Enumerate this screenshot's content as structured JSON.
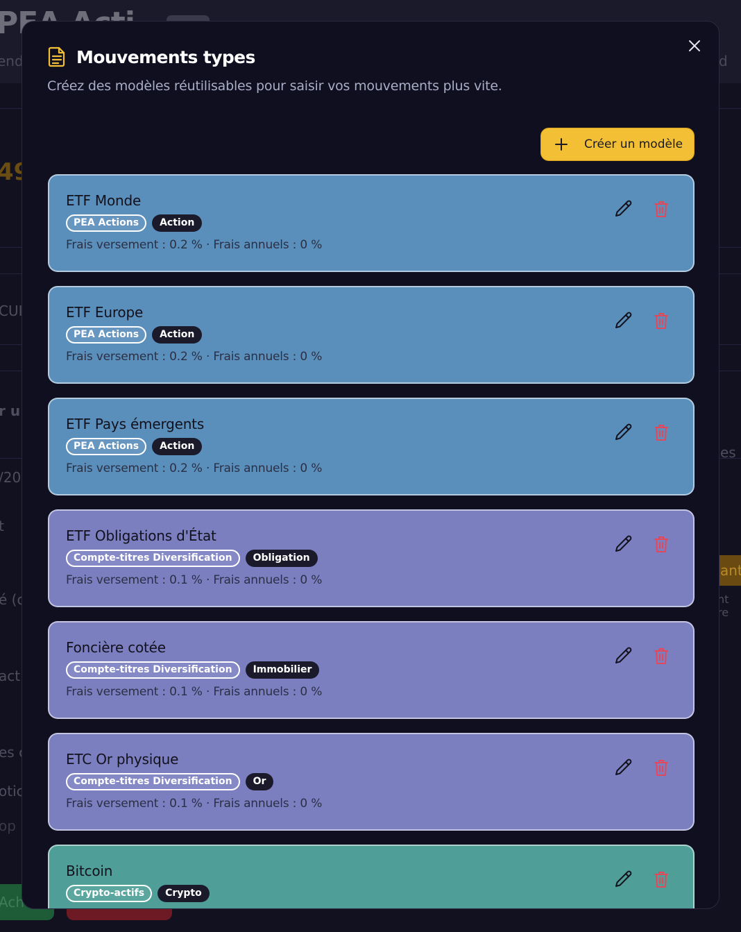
{
  "background": {
    "title_fragment": "PEA Acti",
    "subtitle_fragment": "end",
    "subtitle_fragment_right": "d",
    "value_fragment": "49.",
    "side_fragments": [
      "CUI",
      "r u",
      "/20",
      "t",
      "é (c",
      "acti",
      "es c",
      "otic",
      "op",
      "Ach"
    ],
    "right_fragments": [
      "es",
      "ant",
      "nt re"
    ]
  },
  "modal": {
    "icon": "document-icon",
    "title": "Mouvements types",
    "subtitle": "Créez des modèles réutilisables pour saisir vos mouvements plus vite.",
    "close_icon": "close-icon",
    "create_button": {
      "icon": "plus-icon",
      "label": "Créer un modèle"
    }
  },
  "colors": {
    "accent": "#f3c035",
    "card_pea": "#5b8fbb",
    "card_cto": "#7b7fc0",
    "card_crypto": "#4f9f98",
    "delete": "#e5475a"
  },
  "templates": [
    {
      "name": "ETF Monde",
      "account": "PEA Actions",
      "asset_class": "Action",
      "fees": "Frais versement : 0.2 % · Frais annuels : 0 %",
      "color": "#5b8fbb"
    },
    {
      "name": "ETF Europe",
      "account": "PEA Actions",
      "asset_class": "Action",
      "fees": "Frais versement : 0.2 % · Frais annuels : 0 %",
      "color": "#5b8fbb"
    },
    {
      "name": "ETF Pays émergents",
      "account": "PEA Actions",
      "asset_class": "Action",
      "fees": "Frais versement : 0.2 % · Frais annuels : 0 %",
      "color": "#5b8fbb"
    },
    {
      "name": "ETF Obligations d'État",
      "account": "Compte-titres Diversification",
      "asset_class": "Obligation",
      "fees": "Frais versement : 0.1 % · Frais annuels : 0 %",
      "color": "#7b7fc0"
    },
    {
      "name": "Foncière cotée",
      "account": "Compte-titres Diversification",
      "asset_class": "Immobilier",
      "fees": "Frais versement : 0.1 % · Frais annuels : 0 %",
      "color": "#7b7fc0"
    },
    {
      "name": "ETC Or physique",
      "account": "Compte-titres Diversification",
      "asset_class": "Or",
      "fees": "Frais versement : 0.1 % · Frais annuels : 0 %",
      "color": "#7b7fc0"
    },
    {
      "name": "Bitcoin",
      "account": "Crypto-actifs",
      "asset_class": "Crypto",
      "fees": "",
      "color": "#4f9f98"
    }
  ],
  "row_icons": {
    "edit": "pencil-icon",
    "delete": "trash-icon"
  }
}
